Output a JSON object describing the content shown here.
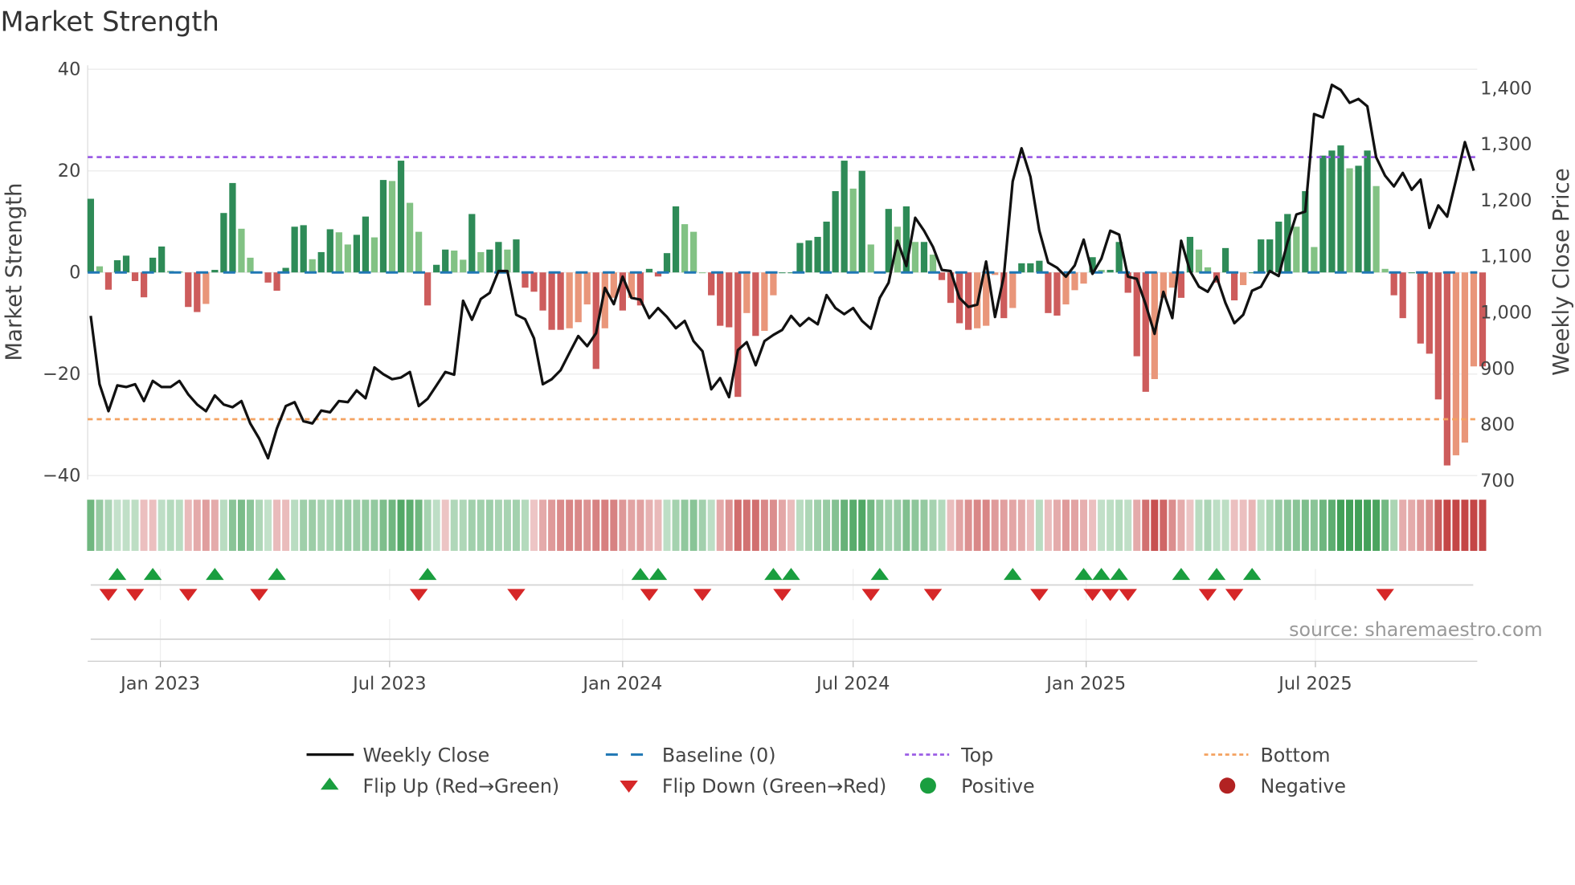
{
  "chart_data": {
    "type": "bar",
    "title": "Market Strength",
    "ylabel": "Market Strength",
    "y2label": "Weekly Close Price",
    "source": "source: sharemaestro.com",
    "start_week": "2022-11-07",
    "frequency": "weekly",
    "ylim": [
      -40,
      40
    ],
    "y2lim": [
      707,
      1432
    ],
    "yticks": [
      {
        "value": 40,
        "label": "40"
      },
      {
        "value": 20,
        "label": "20"
      },
      {
        "value": 0,
        "label": "0"
      },
      {
        "value": -20,
        "label": "−20"
      },
      {
        "value": -40,
        "label": "−40"
      }
    ],
    "y2ticks": [
      {
        "value": 1400,
        "label": "1,400"
      },
      {
        "value": 1300,
        "label": "1,300"
      },
      {
        "value": 1200,
        "label": "1,200"
      },
      {
        "value": 1100,
        "label": "1,100"
      },
      {
        "value": 1000,
        "label": "1,000"
      },
      {
        "value": 900,
        "label": "900"
      },
      {
        "value": 800,
        "label": "800"
      },
      {
        "value": 700,
        "label": "700"
      }
    ],
    "xticks": [
      {
        "date": "2023-01-01",
        "label": "Jan 2023"
      },
      {
        "date": "2023-07-01",
        "label": "Jul 2023"
      },
      {
        "date": "2024-01-01",
        "label": "Jan 2024"
      },
      {
        "date": "2024-07-01",
        "label": "Jul 2024"
      },
      {
        "date": "2025-01-01",
        "label": "Jan 2025"
      },
      {
        "date": "2025-07-01",
        "label": "Jul 2025"
      }
    ],
    "top_level": 22.7,
    "bottom_level": -28.9,
    "baseline": 0,
    "strength": [
      14.5,
      1.2,
      -3.4,
      2.4,
      3.3,
      -1.7,
      -4.9,
      2.9,
      5.1,
      0.3,
      0.2,
      -6.8,
      -7.8,
      -6.2,
      0.5,
      11.7,
      17.6,
      8.6,
      2.9,
      0,
      -2,
      -3.6,
      0.9,
      9,
      9.3,
      2.6,
      4,
      8.5,
      7.9,
      5.5,
      7.4,
      11,
      6.9,
      18.2,
      18,
      22,
      13.7,
      8,
      -6.5,
      1.5,
      4.5,
      4.3,
      2.5,
      11.5,
      4,
      4.5,
      6,
      4.5,
      6.5,
      -3,
      -3.8,
      -7.5,
      -11.3,
      -11.3,
      -11,
      -9.8,
      -6.3,
      -19,
      -11,
      -5,
      -7.5,
      -5,
      -6.5,
      0.7,
      -0.8,
      3.8,
      13,
      9.5,
      8,
      0,
      -4.5,
      -10.5,
      -10.8,
      -24.5,
      -8,
      -12.5,
      -11.5,
      -4.5,
      0,
      0,
      5.8,
      6.3,
      7,
      10,
      16,
      22,
      16.5,
      20,
      5.5,
      0,
      12.5,
      9,
      13,
      6,
      6,
      3.5,
      -1.5,
      -6,
      -10,
      -11.3,
      -11,
      -10.5,
      -0.5,
      -9,
      -7,
      1.8,
      1.8,
      2.3,
      -8,
      -8.5,
      -6.3,
      -3.5,
      -2.2,
      3,
      0.5,
      0.5,
      6,
      -4,
      -16.5,
      -23.5,
      -21,
      -5,
      -3,
      -5,
      7,
      4.5,
      1,
      -2,
      4.8,
      -5.5,
      -2.5,
      0,
      6.5,
      6.5,
      10,
      11.5,
      9,
      16,
      5,
      23,
      24,
      25,
      20.5,
      21,
      24,
      17,
      0.7,
      -4.5,
      -9,
      0,
      -14,
      -16,
      -25,
      -38,
      -36,
      -33.5,
      -18.5,
      -18.5
    ],
    "weekly_close": [
      992,
      870,
      822,
      868,
      865,
      870,
      840,
      876,
      865,
      865,
      876,
      852,
      834,
      822,
      850,
      834,
      829,
      840,
      800,
      773,
      738,
      791,
      831,
      838,
      804,
      800,
      823,
      820,
      840,
      838,
      859,
      845,
      900,
      888,
      879,
      882,
      892,
      831,
      844,
      868,
      892,
      887,
      1019,
      985,
      1022,
      1033,
      1072,
      1072,
      994,
      986,
      952,
      870,
      879,
      895,
      926,
      956,
      938,
      961,
      1042,
      1013,
      1062,
      1024,
      1021,
      988,
      1006,
      990,
      970,
      983,
      947,
      929,
      861,
      881,
      847,
      931,
      945,
      904,
      947,
      958,
      967,
      992,
      974,
      988,
      977,
      1029,
      1006,
      995,
      1006,
      983,
      969,
      1024,
      1051,
      1126,
      1081,
      1167,
      1144,
      1115,
      1074,
      1072,
      1024,
      1008,
      1012,
      1089,
      990,
      1063,
      1232,
      1291,
      1240,
      1144,
      1087,
      1078,
      1062,
      1082,
      1128,
      1067,
      1094,
      1144,
      1137,
      1062,
      1058,
      1012,
      960,
      1035,
      988,
      1126,
      1072,
      1044,
      1035,
      1062,
      1015,
      979,
      994,
      1037,
      1044,
      1072,
      1063,
      1123,
      1173,
      1178,
      1352,
      1346,
      1404,
      1395,
      1372,
      1379,
      1366,
      1275,
      1242,
      1223,
      1247,
      1217,
      1235,
      1149,
      1189,
      1169,
      1234,
      1302,
      1251
    ],
    "flip_up_weeks": [
      3,
      7,
      14,
      21,
      38,
      62,
      64,
      77,
      79,
      89,
      104,
      112,
      114,
      116,
      123,
      127,
      131
    ],
    "flip_down_weeks": [
      2,
      5,
      11,
      19,
      37,
      48,
      63,
      69,
      78,
      88,
      95,
      107,
      113,
      115,
      117,
      126,
      129,
      146
    ],
    "colors": {
      "pos_strong": "#2e8b57",
      "pos_weak": "#82c284",
      "neg_strong": "#cd5c5c",
      "neg_weak": "#e9967a",
      "close": "#111111",
      "baseline": "#1f77b4",
      "top": "#9b5de5",
      "bottom": "#f4a261",
      "flip_up": "#1a9e3f",
      "flip_down": "#d62728",
      "positive": "#1a9e3f",
      "negative": "#b22222"
    },
    "legend": {
      "placement": "bottom",
      "items": [
        {
          "key": "close",
          "label": "Weekly Close"
        },
        {
          "key": "baseline",
          "label": "Baseline (0)"
        },
        {
          "key": "top",
          "label": "Top"
        },
        {
          "key": "bottom",
          "label": "Bottom"
        },
        {
          "key": "flip_up",
          "label": "Flip Up (Red→Green)"
        },
        {
          "key": "flip_down",
          "label": "Flip Down (Green→Red)"
        },
        {
          "key": "positive",
          "label": "Positive"
        },
        {
          "key": "negative",
          "label": "Negative"
        }
      ]
    }
  }
}
